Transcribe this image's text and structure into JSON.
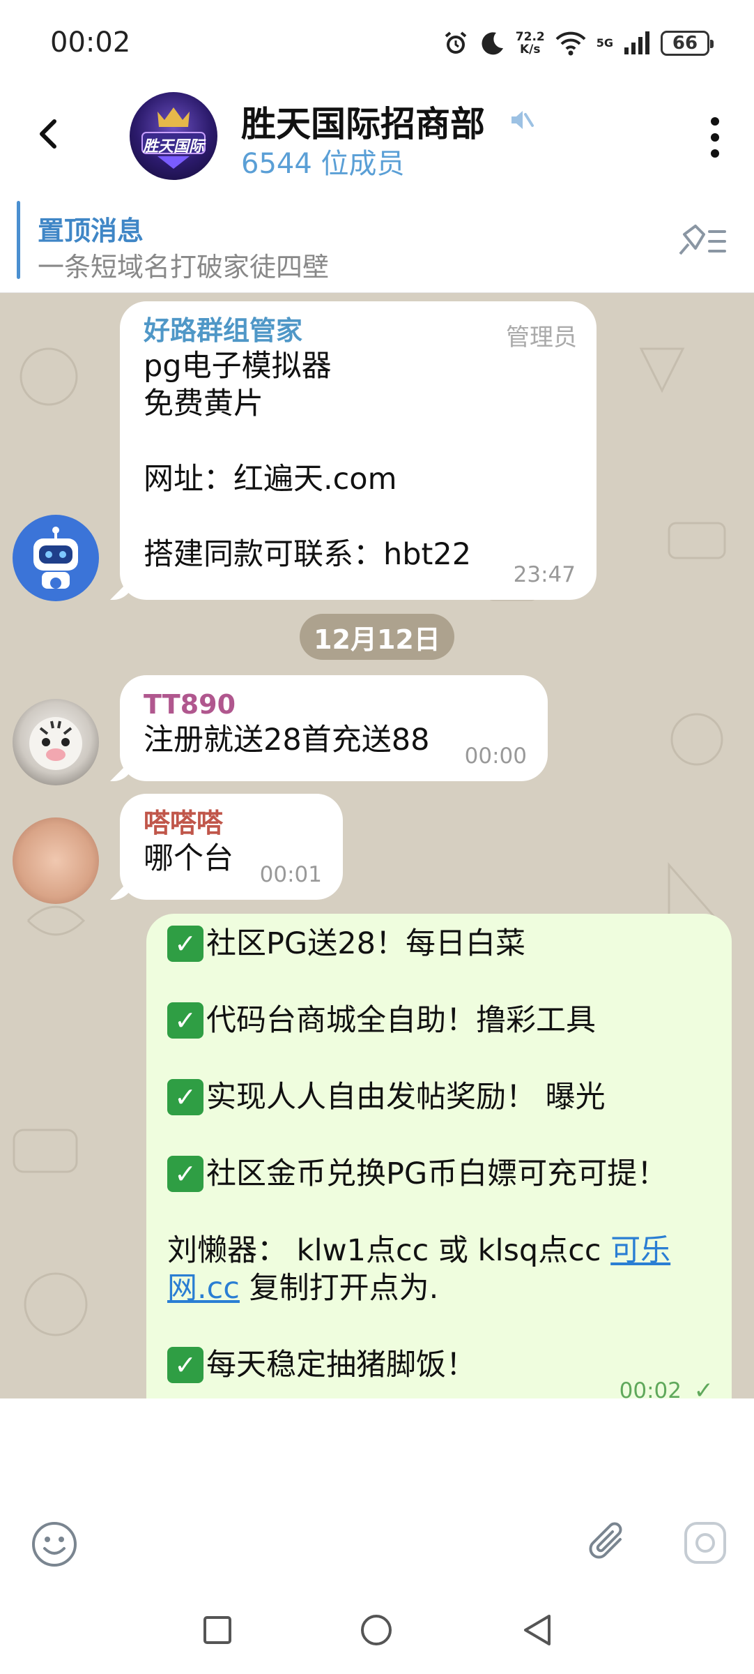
{
  "status_bar": {
    "time": "00:02",
    "net_speed_value": "72.2",
    "net_speed_unit": "K/s",
    "network": "5G",
    "battery": "66"
  },
  "header": {
    "title": "胜天国际招商部",
    "members": "6544 位成员",
    "avatar_text": "胜天国际"
  },
  "pinned": {
    "title": "置顶消息",
    "text": "一条短域名打破家徒四壁"
  },
  "messages": [
    {
      "sender": "好路群组管家",
      "role": "管理员",
      "text": "pg电子模拟器\n免费黄片\n\n网址：红遍天.com\n\n搭建同款可联系：hbt22",
      "time": "23:47",
      "sender_color": "#4f97c7"
    },
    {
      "sender": "TT890",
      "text": "注册就送28首充送88",
      "time": "00:00",
      "sender_color": "#b0578e"
    },
    {
      "sender": "嗒嗒嗒",
      "text": "哪个台",
      "time": "00:01",
      "sender_color": "#c0564a"
    }
  ],
  "date_separator": "12月12日",
  "outgoing": {
    "line1": "社区PG送28！每日白菜",
    "line2": "代码台商城全自助！撸彩工具",
    "line3": "实现人人自由发帖奖励！ 曝光",
    "line4": "社区金币兑换PG币白嫖可充可提！",
    "line5_a": "刘懒器： klw1点cc 或 klsq点cc ",
    "line5_link": "可乐网.cc",
    "line5_b": "  复制打开点为.",
    "line6": "每天稳定抽猪脚饭！",
    "time": "00:02",
    "check_glyph": "✓"
  },
  "colors": {
    "accent": "#3f86c6",
    "chat_background": "#d6cfc1",
    "outgoing_bubble": "#effdde"
  }
}
